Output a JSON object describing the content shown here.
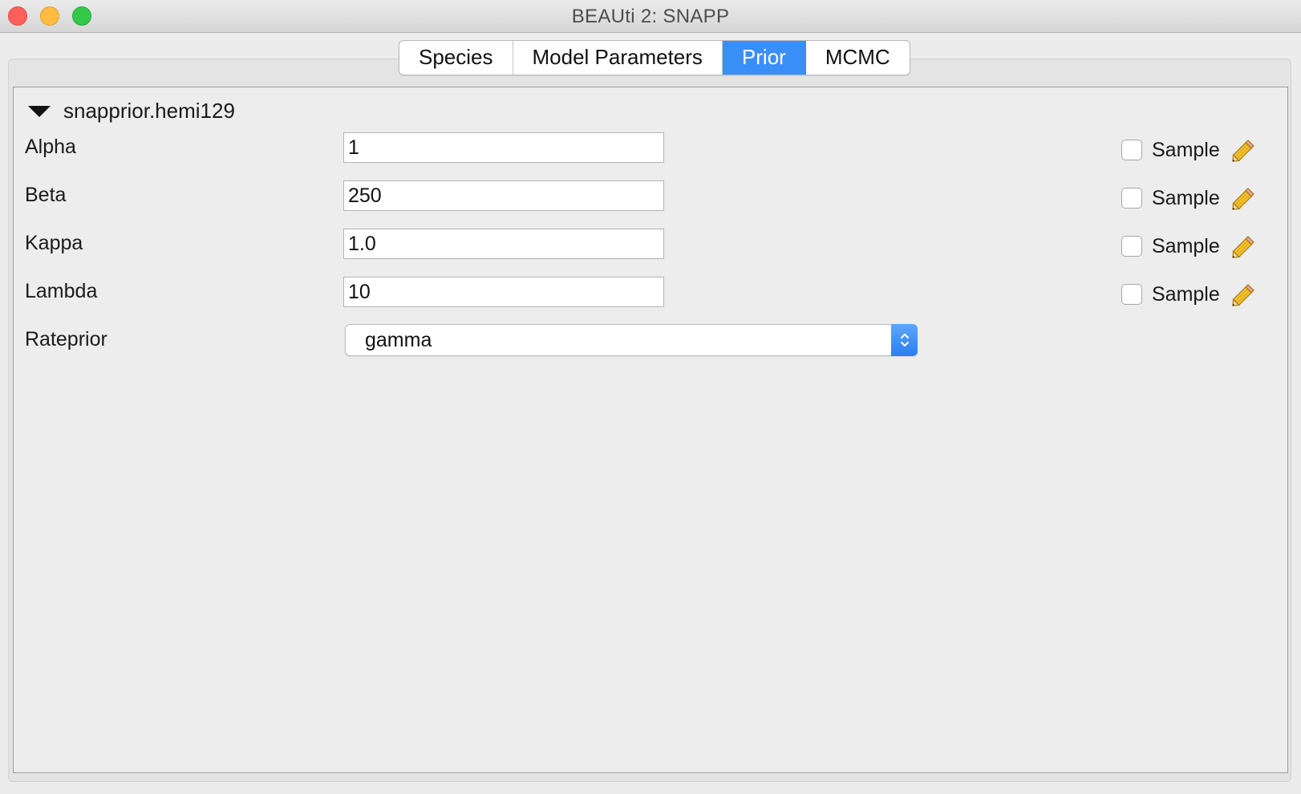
{
  "window": {
    "title": "BEAUti 2: SNAPP"
  },
  "tabs": [
    {
      "label": "Species",
      "active": false
    },
    {
      "label": "Model Parameters",
      "active": false
    },
    {
      "label": "Prior",
      "active": true
    },
    {
      "label": "MCMC",
      "active": false
    }
  ],
  "section": {
    "title": "snapprior.hemi129",
    "expanded": true
  },
  "params": [
    {
      "label": "Alpha",
      "value": "1",
      "sample_label": "Sample",
      "sample_checked": false
    },
    {
      "label": "Beta",
      "value": "250",
      "sample_label": "Sample",
      "sample_checked": false
    },
    {
      "label": "Kappa",
      "value": "1.0",
      "sample_label": "Sample",
      "sample_checked": false
    },
    {
      "label": "Lambda",
      "value": "10",
      "sample_label": "Sample",
      "sample_checked": false
    }
  ],
  "rateprior": {
    "label": "Rateprior",
    "value": "gamma"
  },
  "icons": {
    "disclosure": "disclosure-triangle-down-icon",
    "edit": "pencil-icon",
    "select_arrows": "updown-chevron-icon"
  },
  "colors": {
    "accent": "#3a8ff7",
    "close": "#fc605b",
    "minimize": "#fdbc40",
    "maximize": "#34c84a",
    "pencil": "#f2c230"
  }
}
